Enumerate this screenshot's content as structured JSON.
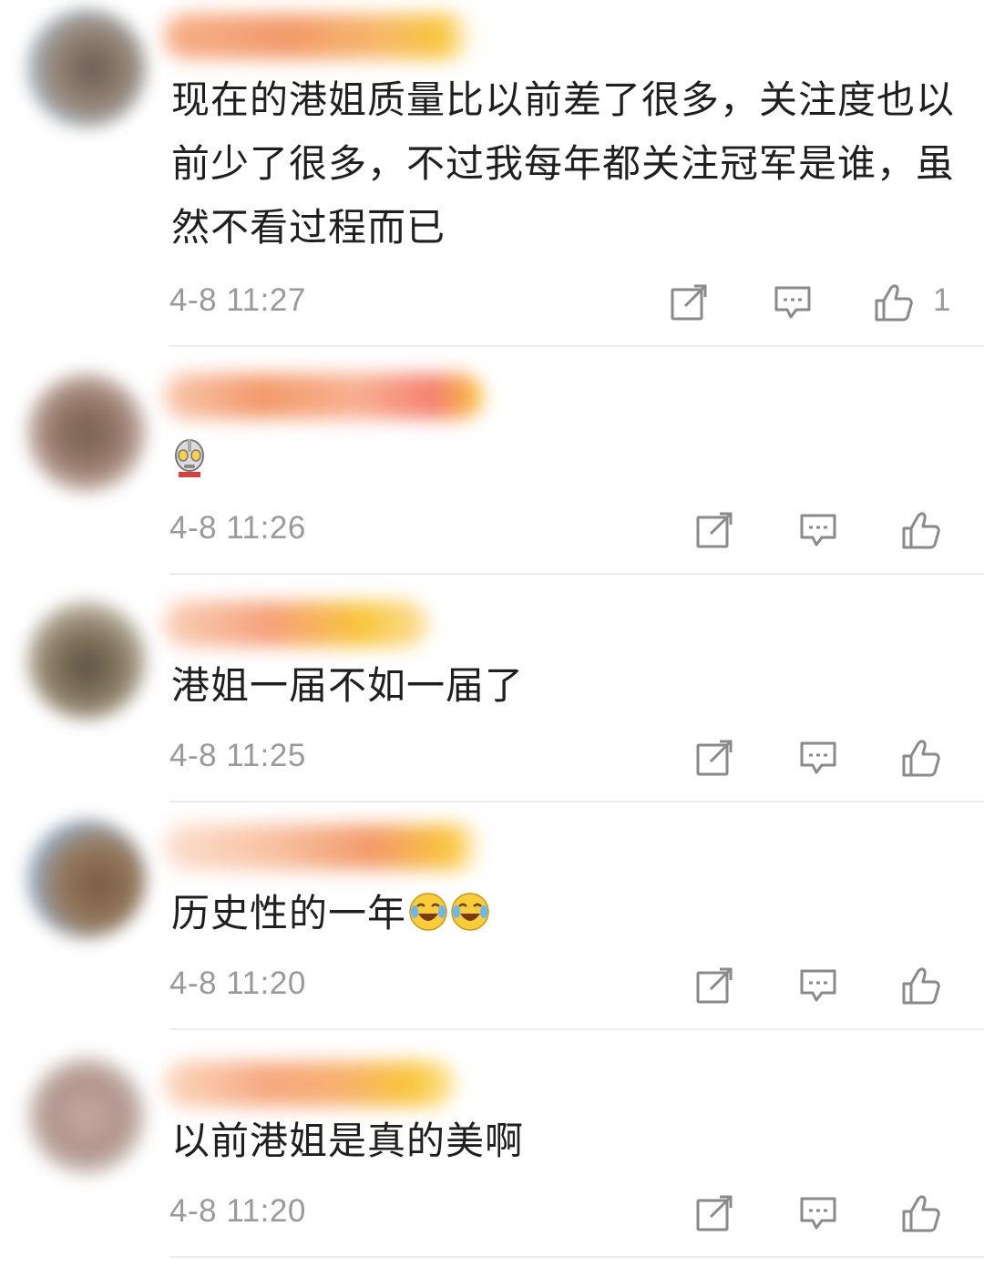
{
  "comments": [
    {
      "text": "现在的港姐质量比以前差了很多，关注度也以前少了很多，不过我每年都关注冠军是谁，虽然不看过程而已",
      "time": "4-8 11:27",
      "likes": "1"
    },
    {
      "text": "",
      "time": "4-8 11:26",
      "likes": ""
    },
    {
      "text": "港姐一届不如一届了",
      "time": "4-8 11:25",
      "likes": ""
    },
    {
      "text": "历史性的一年",
      "time": "4-8 11:20",
      "likes": ""
    },
    {
      "text": "以前港姐是真的美啊",
      "time": "4-8 11:20",
      "likes": ""
    }
  ],
  "icons": {
    "forward": "share-edit-icon",
    "comment": "comment-bubble-icon",
    "like": "thumbs-up-icon",
    "sticker_robot": "ultraman-sticker-icon",
    "emoji_cry": "laugh-cry-emoji-icon"
  },
  "colors": {
    "text": "#1f1f1f",
    "meta": "#9a9a9a",
    "icon": "#8a8a8a",
    "divider": "#ececec",
    "username_blur_orange": "#f6a06a",
    "username_blur_yellow": "#f9c53b"
  }
}
